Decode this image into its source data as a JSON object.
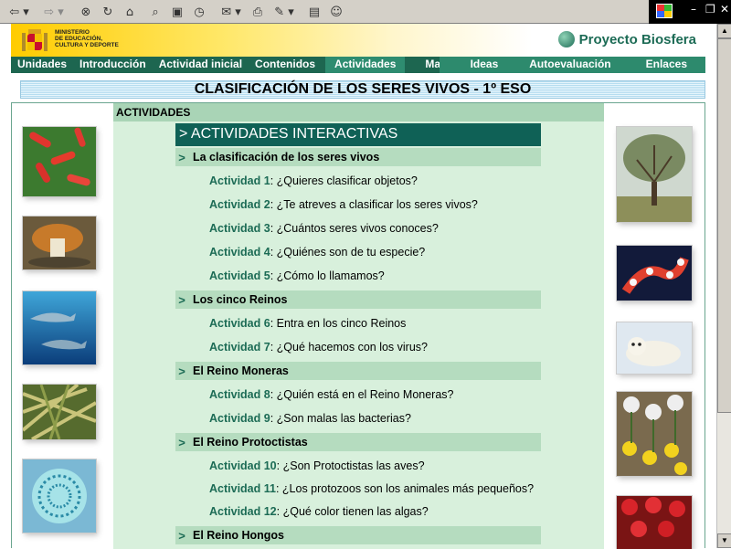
{
  "site": {
    "ministry_lines": [
      "MINISTERIO",
      "DE EDUCACIÓN,",
      "CULTURA Y DEPORTE"
    ],
    "project_name": "Proyecto Biosfera"
  },
  "nav": {
    "left_items": [
      "Unidades",
      "Introducción",
      "Actividad inicial",
      "Contenidos",
      "Actividades",
      "Mapa"
    ],
    "right_items": [
      "Ideas",
      "Autoevaluación",
      "Enlaces"
    ],
    "active_item": "Actividades"
  },
  "page": {
    "title": "CLASIFICACIÓN DE LOS SERES VIVOS - 1º ESO",
    "section_label": "ACTIVIDADES",
    "box_header": "> ACTIVIDADES INTERACTIVAS"
  },
  "groups": [
    {
      "title": "La clasificación de los seres vivos",
      "activities": [
        {
          "label": "Actividad 1",
          "text": "¿Quieres clasificar objetos?"
        },
        {
          "label": "Actividad 2",
          "text": "¿Te atreves a clasificar los seres vivos?"
        },
        {
          "label": "Actividad 3",
          "text": "¿Cuántos seres vivos conoces?"
        },
        {
          "label": "Actividad 4",
          "text": "¿Quiénes son de tu especie?"
        },
        {
          "label": "Actividad 5",
          "text": "¿Cómo lo llamamos?"
        }
      ]
    },
    {
      "title": "Los cinco Reinos",
      "activities": [
        {
          "label": "Actividad 6",
          "text": "Entra en los cinco Reinos"
        },
        {
          "label": "Actividad 7",
          "text": "¿Qué hacemos con los virus?"
        }
      ]
    },
    {
      "title": "El Reino Moneras",
      "activities": [
        {
          "label": "Actividad 8",
          "text": "¿Quién está en el Reino Moneras?"
        },
        {
          "label": "Actividad 9",
          "text": "¿Son malas las bacterias?"
        }
      ]
    },
    {
      "title": "El Reino Protoctistas",
      "activities": [
        {
          "label": "Actividad 10",
          "text": "¿Son Protoctistas las aves?"
        },
        {
          "label": "Actividad 11",
          "text": "¿Los protozoos son los animales más pequeños?"
        },
        {
          "label": "Actividad 12",
          "text": "¿Qué color tienen las algas?"
        }
      ]
    },
    {
      "title": "El Reino Hongos",
      "activities": []
    }
  ],
  "colors": {
    "nav_bg": "#1d6650",
    "box_header_bg": "#0f6156",
    "content_bg": "#d8f0dc",
    "group_bg": "#b5dcbf",
    "link": "#1c6b55"
  }
}
